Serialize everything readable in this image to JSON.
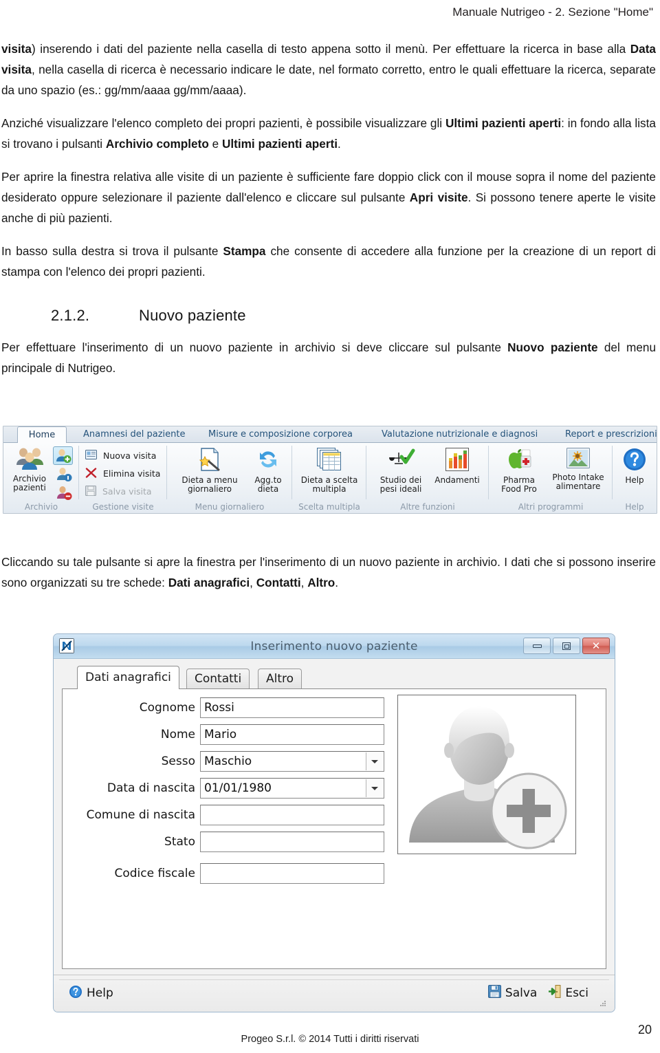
{
  "header": {
    "title": "Manuale Nutrigeo - 2. Sezione \"Home\""
  },
  "paragraphs": {
    "p1_a": "visita",
    "p1_b": ") inserendo i dati del paziente nella casella di testo appena sotto il menù. Per effettuare la ricerca in base alla ",
    "p1_c": "Data visita",
    "p1_d": ", nella casella di ricerca è necessario indicare le date, nel formato corretto, entro le quali effettuare la ricerca, separate da uno spazio (es.: gg/mm/aaaa gg/mm/aaaa).",
    "p2_a": "Anziché visualizzare l'elenco completo dei propri pazienti, è possibile visualizzare gli ",
    "p2_b": "Ultimi pazienti aperti",
    "p2_c": ": in fondo alla lista si trovano i pulsanti ",
    "p2_d": "Archivio completo",
    "p2_e": " e ",
    "p2_f": "Ultimi pazienti aperti",
    "p2_g": ".",
    "p3_a": "Per aprire la finestra relativa alle visite di un paziente è sufficiente fare doppio click con il mouse sopra il nome del paziente desiderato oppure selezionare il paziente dall'elenco e cliccare sul pulsante ",
    "p3_b": "Apri visite",
    "p3_c": ". Si possono tenere aperte le visite anche di più pazienti.",
    "p4_a": "In basso sulla destra si trova il pulsante ",
    "p4_b": "Stampa",
    "p4_c": " che consente di accedere alla funzione per la creazione di un report di stampa con l'elenco dei propri pazienti.",
    "p5_a": "Per effettuare l'inserimento di un nuovo paziente in archivio si deve cliccare sul pulsante ",
    "p5_b": "Nuovo paziente",
    "p5_c": " del menu principale di Nutrigeo.",
    "p6_a": "Cliccando su tale pulsante si apre la finestra per l'inserimento di un nuovo paziente in archivio. I dati che si possono inserire sono organizzati su tre schede: ",
    "p6_b": "Dati anagrafici",
    "p6_c": ", ",
    "p6_d": "Contatti",
    "p6_e": ", ",
    "p6_f": "Altro",
    "p6_g": "."
  },
  "section": {
    "number": "2.1.2.",
    "title": "Nuovo paziente"
  },
  "ribbon": {
    "tabs": [
      {
        "label": "Home",
        "active": true
      },
      {
        "label": "Anamnesi del paziente",
        "active": false
      },
      {
        "label": "Misure e composizione corporea",
        "active": false
      },
      {
        "label": "Valutazione nutrizionale e diagnosi",
        "active": false
      },
      {
        "label": "Report e prescrizioni",
        "active": false
      }
    ],
    "groups": [
      {
        "name": "Archivio"
      },
      {
        "name": "Gestione visite"
      },
      {
        "name": "Menu giornaliero"
      },
      {
        "name": "Scelta multipla"
      },
      {
        "name": "Altre funzioni"
      },
      {
        "name": "Altri programmi"
      },
      {
        "name": "Help"
      }
    ],
    "buttons": {
      "archivio_pazienti_l1": "Archivio",
      "archivio_pazienti_l2": "pazienti",
      "nuova_visita": "Nuova visita",
      "elimina_visita": "Elimina visita",
      "salva_visita": "Salva visita",
      "dieta_menu_l1": "Dieta a menu",
      "dieta_menu_l2": "giornaliero",
      "aggto_dieta_l1": "Agg.to",
      "aggto_dieta_l2": "dieta",
      "dieta_scelta_l1": "Dieta a scelta",
      "dieta_scelta_l2": "multipla",
      "studio_pesi_l1": "Studio dei",
      "studio_pesi_l2": "pesi ideali",
      "andamenti": "Andamenti",
      "pharma_l1": "Pharma",
      "pharma_l2": "Food Pro",
      "photo_intake_l1": "Photo Intake",
      "photo_intake_l2": "alimentare",
      "help": "Help"
    }
  },
  "dialog": {
    "title": "Inserimento nuovo paziente",
    "window_buttons": {
      "minimize": "Riduci a icona",
      "maximize": "Ingrandisci",
      "close": "Chiudi"
    },
    "tabs": [
      {
        "label": "Dati anagrafici",
        "active": true
      },
      {
        "label": "Contatti",
        "active": false
      },
      {
        "label": "Altro",
        "active": false
      }
    ],
    "fields": [
      {
        "label": "Cognome",
        "value": "Rossi",
        "type": "text"
      },
      {
        "label": "Nome",
        "value": "Mario",
        "type": "text"
      },
      {
        "label": "Sesso",
        "value": "Maschio",
        "type": "combo"
      },
      {
        "label": "Data di nascita",
        "value": "01/01/1980",
        "type": "combo"
      },
      {
        "label": "Comune di nascita",
        "value": "",
        "type": "text"
      },
      {
        "label": "Stato",
        "value": "",
        "type": "text"
      },
      {
        "label": "Codice fiscale",
        "value": "",
        "type": "text"
      }
    ],
    "footer": {
      "help": "Help",
      "save": "Salva",
      "exit": "Esci"
    }
  },
  "page": {
    "number": "20",
    "footer": "Progeo S.r.l. © 2014 Tutti i diritti riservati"
  },
  "colors": {
    "header_text": "#231f20",
    "dialog_title_bar": "#bcd8ee",
    "close_button": "#cf5c52",
    "ribbon_tab_text": "#24527a",
    "selected_ribbon_button": "#bfe3f6"
  }
}
